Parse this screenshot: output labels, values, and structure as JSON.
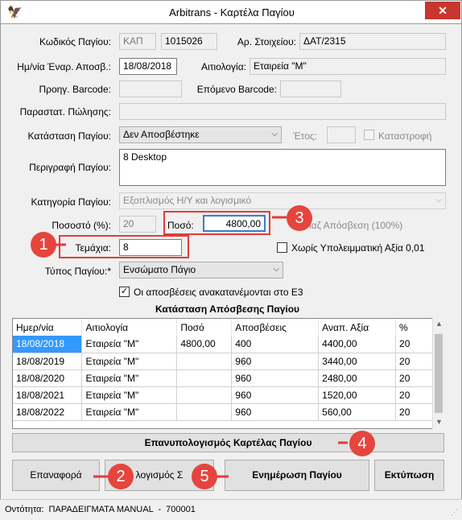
{
  "window": {
    "title": "Arbitrans - Καρτέλα Παγίου",
    "close_glyph": "✕",
    "app_icon": "bird-icon"
  },
  "form": {
    "asset_code": {
      "label": "Κωδικός Παγίου:",
      "prefix": "ΚΑΠ",
      "value": "1015026"
    },
    "doc_no": {
      "label": "Αρ. Στοιχείου:",
      "value": "ΔΑΤ/2315"
    },
    "start_date": {
      "label": "Ημ/νία Έναρ. Αποσβ.:",
      "value": "18/08/2018"
    },
    "reason": {
      "label": "Αιτιολογία:",
      "value": "Εταιρεία \"Μ\""
    },
    "prev_barcode": {
      "label": "Προηγ. Barcode:",
      "value": ""
    },
    "next_barcode": {
      "label": "Επόμενο Barcode:",
      "value": ""
    },
    "sale_doc": {
      "label": "Παραστατ. Πώλησης:",
      "value": ""
    },
    "status": {
      "label": "Κατάσταση Παγίου:",
      "value": "Δεν Αποσβέστηκε"
    },
    "year": {
      "label": "Έτος:",
      "value": ""
    },
    "destruction": {
      "label": "Καταστροφή",
      "checked": false
    },
    "description": {
      "label": "Περιγραφή Παγίου:",
      "value": "8 Desktop"
    },
    "category": {
      "label": "Κατηγορία Παγίου:",
      "value": "Εξοπλισμός Η/Υ και λογισμικό"
    },
    "percent": {
      "label": "Ποσοστό (%):",
      "value": "20"
    },
    "amount": {
      "label": "Ποσό:",
      "value": "4800,00"
    },
    "full_depr": {
      "label": "ιαζ Απόσβεση (100%)"
    },
    "pieces": {
      "label": "Τεμάχια:",
      "value": "8"
    },
    "no_residual": {
      "label": "Χωρίς Υπολειμματική Αξία 0,01",
      "checked": false
    },
    "asset_type": {
      "label": "Τύπος Παγίου:*",
      "value": "Ενσώματο Πάγιο"
    },
    "e3_check": {
      "label": "Οι αποσβέσεις ανακατανέμονται στο Ε3",
      "checked": true
    }
  },
  "schedule": {
    "title": "Κατάσταση Απόσβεσης Παγίου",
    "columns": [
      "Ημερ/νία",
      "Αιτιολογία",
      "Ποσό",
      "Αποσβέσεις",
      "Αναπ. Αξία",
      "%"
    ],
    "rows": [
      [
        "18/08/2018",
        "Εταιρεία \"Μ\"",
        "4800,00",
        "400",
        "4400,00",
        "20"
      ],
      [
        "18/08/2019",
        "Εταιρεία \"Μ\"",
        "",
        "960",
        "3440,00",
        "20"
      ],
      [
        "18/08/2020",
        "Εταιρεία \"Μ\"",
        "",
        "960",
        "2480,00",
        "20"
      ],
      [
        "18/08/2021",
        "Εταιρεία \"Μ\"",
        "",
        "960",
        "1520,00",
        "20"
      ],
      [
        "18/08/2022",
        "Εταιρεία \"Μ\"",
        "",
        "960",
        "560,00",
        "20"
      ]
    ]
  },
  "buttons": {
    "recalc": "Επανυπολογισμός Καρτέλας Παγίου",
    "reset": "Επαναφορά",
    "calc_partial": "λογισμός Σ",
    "update": "Ενημέρωση Παγίου",
    "print": "Εκτύπωση"
  },
  "status_bar": {
    "text": "Οντότητα:  ΠΑΡΑΔΕΙΓΜΑΤΑ MANUAL  -  700001"
  },
  "callouts": [
    "1",
    "2",
    "3",
    "4",
    "5"
  ],
  "colors": {
    "callout": "#e5453d",
    "selection": "#3399ff",
    "close": "#c7372f"
  }
}
